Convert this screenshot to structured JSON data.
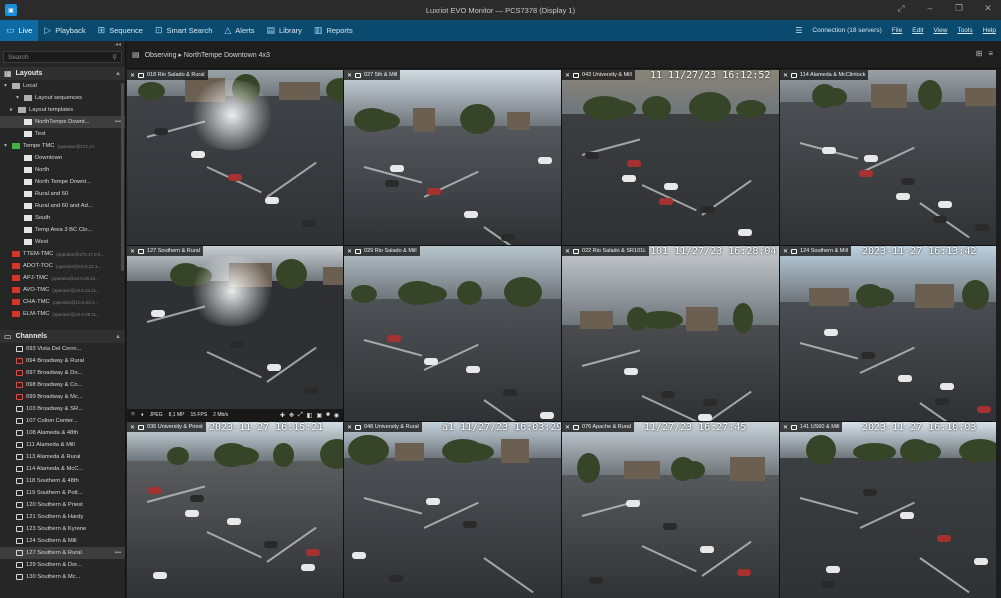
{
  "window": {
    "title": "Luxriot EVO Monitor — PCS7378 (Display 1)"
  },
  "tabs": [
    {
      "label": "Live",
      "icon": "live-icon",
      "active": true
    },
    {
      "label": "Playback",
      "icon": "playback-icon"
    },
    {
      "label": "Sequence",
      "icon": "sequence-icon"
    },
    {
      "label": "Smart Search",
      "icon": "smart-search-icon"
    },
    {
      "label": "Alerts",
      "icon": "alerts-icon"
    },
    {
      "label": "Library",
      "icon": "library-icon"
    },
    {
      "label": "Reports",
      "icon": "reports-icon"
    }
  ],
  "right_menu": {
    "connection": "Connection (18 servers)",
    "items": [
      "File",
      "Edit",
      "View",
      "Tools",
      "Help"
    ]
  },
  "sidebar": {
    "search_placeholder": "Search",
    "layouts_title": "Layouts",
    "layouts": [
      {
        "label": "Local",
        "kind": "folder",
        "indent": 0
      },
      {
        "label": "Layout sequences",
        "kind": "folder",
        "indent": 2
      },
      {
        "label": "Layout templates",
        "kind": "folder",
        "indent": 1
      },
      {
        "label": "NorthTempe Downt...",
        "kind": "layout",
        "indent": 2,
        "selected": true,
        "tail": "•••"
      },
      {
        "label": "Test",
        "kind": "layout",
        "indent": 2
      },
      {
        "label": "Tempe TMC",
        "sub": "(operator@172.17...",
        "kind": "green",
        "indent": 0
      },
      {
        "label": "Downtown",
        "kind": "layout",
        "indent": 2
      },
      {
        "label": "North",
        "kind": "layout",
        "indent": 2
      },
      {
        "label": "North Tempe Downt...",
        "kind": "layout",
        "indent": 2
      },
      {
        "label": "Rural and 60",
        "kind": "layout",
        "indent": 2
      },
      {
        "label": "Rural and 60 and Ad...",
        "kind": "layout",
        "indent": 2
      },
      {
        "label": "South",
        "kind": "layout",
        "indent": 2
      },
      {
        "label": "Temp Area 3 BC Clo...",
        "kind": "layout",
        "indent": 2
      },
      {
        "label": "West",
        "kind": "layout",
        "indent": 2
      },
      {
        "label": "TTEM-TMC",
        "sub": "(operator@172.17.0.5...",
        "kind": "red",
        "indent": 0
      },
      {
        "label": "ADOT-TOC",
        "sub": "(operator@10.0.22.1...",
        "kind": "red",
        "indent": 0
      },
      {
        "label": "APJ-TMC",
        "sub": "(operator@10.0.26.10...",
        "kind": "red",
        "indent": 0
      },
      {
        "label": "AVO-TMC",
        "sub": "(operator@10.0.24.11...",
        "kind": "red",
        "indent": 0
      },
      {
        "label": "CHA-TMC",
        "sub": "(operator@10.0.23.1...",
        "kind": "red",
        "indent": 0
      },
      {
        "label": "ELM-TMC",
        "sub": "(operator@10.0.28.11...",
        "kind": "red",
        "indent": 0
      }
    ],
    "channels_title": "Channels",
    "channels": [
      {
        "label": "093 Vista Del Cerro...",
        "red": false
      },
      {
        "label": "094 Broadway & Rural",
        "red": true
      },
      {
        "label": "097 Broadway & Do...",
        "red": true
      },
      {
        "label": "098 Broadway & Co...",
        "red": true
      },
      {
        "label": "099 Broadway & Mc...",
        "red": true
      },
      {
        "label": "103 Broadway & SR...",
        "red": false
      },
      {
        "label": "107 Colton Center...",
        "red": false
      },
      {
        "label": "108 Alameda & 48th",
        "red": false
      },
      {
        "label": "111 Alameda & Mill",
        "red": false
      },
      {
        "label": "113 Alameda & Rural",
        "red": false
      },
      {
        "label": "114 Alameda & McC...",
        "red": false
      },
      {
        "label": "118 Southern & 48th",
        "red": false
      },
      {
        "label": "119 Southern & Pott...",
        "red": false
      },
      {
        "label": "120 Southern & Priest",
        "red": false
      },
      {
        "label": "121 Southern & Hardy",
        "red": false
      },
      {
        "label": "123 Southern & Kyrene",
        "red": false
      },
      {
        "label": "124 Southern & Mill",
        "red": false
      },
      {
        "label": "127 Southern & Rural",
        "red": false,
        "selected": true,
        "tail": "•••"
      },
      {
        "label": "129 Southern & Dor...",
        "red": false
      },
      {
        "label": "130 Southern & Mc...",
        "red": false
      }
    ]
  },
  "main": {
    "observing": "Observing ▸ NorthTempe Downtown 4x3"
  },
  "cameras": [
    {
      "name": "018 Rio Salado & Rural",
      "stamp": "",
      "scene": 1
    },
    {
      "name": "027 5th & Mill",
      "stamp": "",
      "scene": 2
    },
    {
      "name": "043 University & Mill",
      "stamp": "11 11/27/23 16:12:52",
      "scene": 3
    },
    {
      "name": "114 Alameda & McClintock",
      "stamp": "",
      "scene": 4
    },
    {
      "name": "127 Southern & Rural",
      "stamp": "",
      "scene": 5,
      "selected": true,
      "stats": {
        "codec": "JPEG",
        "res": "8,1 MP",
        "fps": "15 FPS",
        "rate": "2 Mb/s"
      }
    },
    {
      "name": "029 Rio Salado & Mill",
      "stamp": "",
      "scene": 6
    },
    {
      "name": "022 Rio Salado & SR101L",
      "stamp": "101 11/27/23 16:28:04",
      "scene": 7
    },
    {
      "name": "124 Southern & Mill",
      "stamp": "2023-11-27 16:13:42",
      "scene": 8
    },
    {
      "name": "036 University & Priest",
      "stamp": "2023-11-27 16:15:21",
      "scene": 9
    },
    {
      "name": "048 University & Rural",
      "stamp": "a1 11/27/23 16:03:29",
      "scene": 10
    },
    {
      "name": "076 Apache & Rural",
      "stamp": "11/27/23 16:27:45",
      "scene": 11
    },
    {
      "name": "141 US60 & Mill",
      "stamp": "2023-11-27 16:10:03",
      "scene": 12
    }
  ],
  "colors": {
    "accent": "#0e6aa3",
    "menubar": "#0b4a6f",
    "selected_outline": "#d9c31d",
    "offline": "#d7352b",
    "online": "#43b14a"
  }
}
